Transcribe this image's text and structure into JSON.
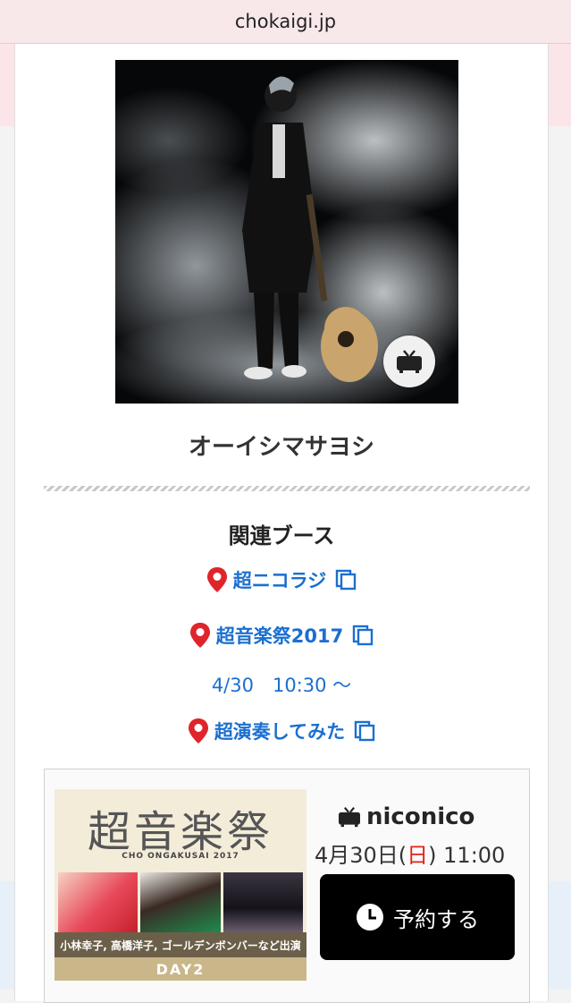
{
  "browser": {
    "domain": "chokaigi.jp"
  },
  "artist": {
    "name": "オーイシマサヨシ",
    "photo_icon": "tv-icon"
  },
  "related": {
    "title": "関連ブース",
    "booths": [
      {
        "name": "超ニコラジ"
      },
      {
        "name": "超音楽祭2017"
      },
      {
        "name": "超演奏してみた"
      }
    ],
    "schedule": "4/30　10:30 ～"
  },
  "promo": {
    "banner_title": "超音楽祭",
    "banner_subtitle": "CHO ONGAKUSAI 2017",
    "banner_caption": "小林幸子, 高橋洋子, ゴールデンボンバーなど出演",
    "banner_day": "DAY2",
    "logo_text": "niconico",
    "date_prefix": "4月30日(",
    "date_weekday": "日",
    "date_suffix": ") 11:00",
    "reserve_label": "予約する"
  },
  "colors": {
    "link": "#1a6fd1",
    "pin": "#e0242b",
    "weekday": "#e2231a"
  }
}
